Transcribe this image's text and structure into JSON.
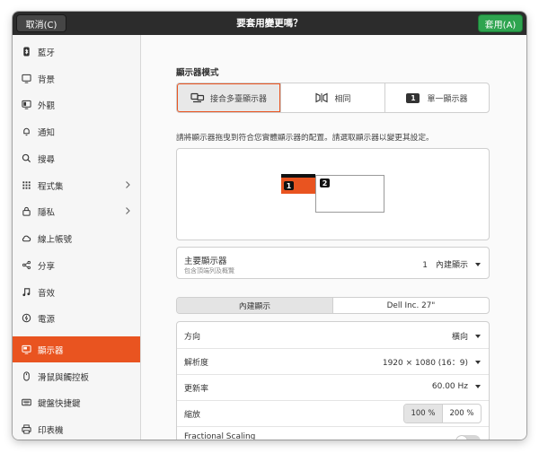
{
  "headerbar": {
    "cancel_label": "取消(C)",
    "title": "要套用變更嗎？",
    "apply_label": "套用(A)"
  },
  "sidebar": {
    "items": [
      {
        "label": "藍牙",
        "icon": "bluetooth-icon"
      },
      {
        "label": "背景",
        "icon": "background-icon"
      },
      {
        "label": "外觀",
        "icon": "appearance-icon"
      },
      {
        "label": "通知",
        "icon": "bell-icon"
      },
      {
        "label": "搜尋",
        "icon": "search-icon"
      },
      {
        "label": "程式集",
        "icon": "apps-grid-icon",
        "chevron": true
      },
      {
        "label": "隱私",
        "icon": "lock-icon",
        "chevron": true
      },
      {
        "label": "線上帳號",
        "icon": "cloud-icon"
      },
      {
        "label": "分享",
        "icon": "share-icon"
      },
      {
        "label": "音效",
        "icon": "music-note-icon"
      },
      {
        "label": "電源",
        "icon": "power-icon"
      },
      {
        "label": "顯示器",
        "icon": "display-icon",
        "active": true
      },
      {
        "label": "滑鼠與觸控板",
        "icon": "mouse-icon"
      },
      {
        "label": "鍵盤快捷鍵",
        "icon": "keyboard-icon"
      },
      {
        "label": "印表機",
        "icon": "printer-icon"
      }
    ]
  },
  "display_mode": {
    "heading": "顯示器模式",
    "options": [
      {
        "label": "接合多臺顯示器",
        "icon": "join-displays-icon",
        "active": true
      },
      {
        "label": "相同",
        "icon": "mirror-icon"
      },
      {
        "label": "單一顯示器",
        "icon": "single-display-icon",
        "badge": "1"
      }
    ]
  },
  "arrangement": {
    "description": "請將顯示器拖曳到符合您實體顯示器的配置。請選取顯示器以變更其設定。",
    "monitor_1_label": "1",
    "monitor_2_label": "2"
  },
  "primary_display": {
    "title": "主要顯示器",
    "subtitle": "包含頂端列及概覽",
    "value": "1　內建顯示"
  },
  "monitor_tabs": [
    "內建顯示",
    "Dell Inc. 27\""
  ],
  "settings": {
    "orientation_label": "方向",
    "orientation_value": "橫向",
    "resolution_label": "解析度",
    "resolution_value": "1920 × 1080 (16：9)",
    "refresh_label": "更新率",
    "refresh_value": "60.00 Hz",
    "scale_label": "縮放",
    "scale_options": [
      "100 %",
      "200 %"
    ],
    "fractional_label": "Fractional Scaling"
  },
  "colors": {
    "accent": "#e95420",
    "apply_green": "#2ea44f",
    "headerbar": "#2c2c2c"
  }
}
